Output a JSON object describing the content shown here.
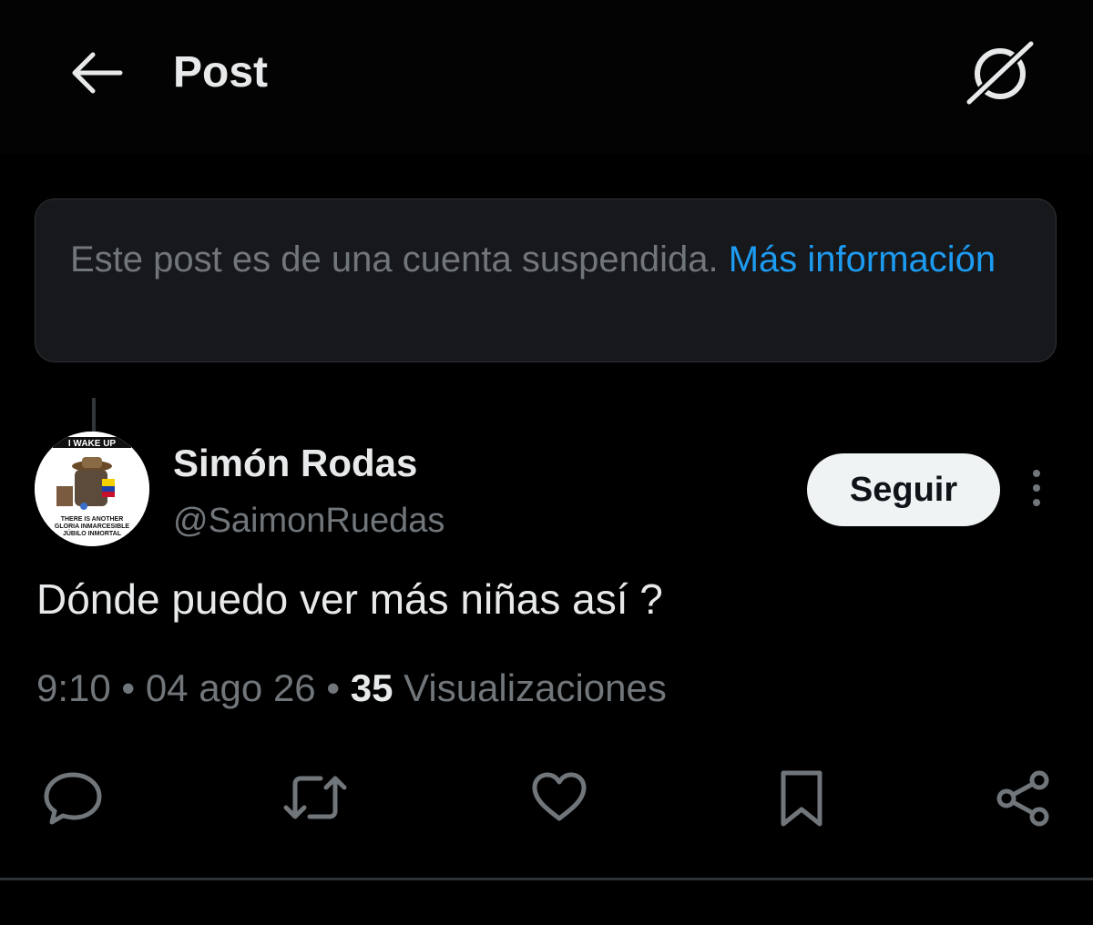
{
  "header": {
    "title": "Post",
    "back_icon": "arrow-left-icon",
    "grok_icon": "grok-slash-circle-icon"
  },
  "notice": {
    "text": "Este post es de una cuenta suspendida. ",
    "link": "Más información"
  },
  "author": {
    "display_name": "Simón Rodas",
    "handle": "@SaimonRuedas",
    "avatar_text_top": "I WAKE UP",
    "avatar_text_lines": [
      "THERE IS ANOTHER",
      "GLORIA INMARCESIBLE",
      "JÚBILO INMORTAL"
    ]
  },
  "follow_button": "Seguir",
  "post": {
    "text": "Dónde puedo ver más niñas así ?",
    "time": "9:10",
    "date": "04 ago 26",
    "separator": "•",
    "views_count": "35",
    "views_label": "Visualizaciones"
  },
  "actions": [
    {
      "name": "reply",
      "icon": "reply-bubble-icon"
    },
    {
      "name": "repost",
      "icon": "repost-icon"
    },
    {
      "name": "like",
      "icon": "heart-icon"
    },
    {
      "name": "bookmark",
      "icon": "bookmark-icon"
    },
    {
      "name": "share",
      "icon": "share-icon"
    }
  ],
  "colors": {
    "background": "#000000",
    "text_primary": "#e7e9ea",
    "text_secondary": "#71767b",
    "link": "#1d9bf0",
    "notice_bg": "#16181c",
    "border": "#2f3336",
    "follow_bg": "#eff3f4"
  }
}
